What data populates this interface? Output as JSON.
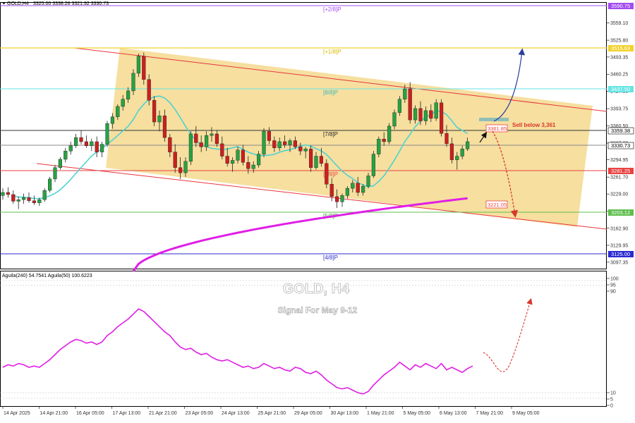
{
  "header": {
    "symbol_text": "GOLD,H4",
    "ohlc_text": "3325.00 3338.26 3321.92 3330.73"
  },
  "indicator": {
    "legend_text": "Aguila(240) 54.7541 Aguila(50) 100.6223",
    "watermark_title": "GOLD, H4",
    "watermark_subtitle": "Signal For May 9-12"
  },
  "annotations": {
    "sell_text": "Sell below 3,361"
  },
  "colors": {
    "bull_candle": "#27a243",
    "bear_candle": "#cc1f1f",
    "sma_short": "#4fd2d0",
    "sma_long": "#e01ee6",
    "channel_fill": "#f5d98e",
    "channel_line": "#e8353b",
    "oscillator": "#e01ee6",
    "blue_arrow": "#2a3f9d",
    "red_arrow": "#d9362b"
  },
  "chart_data": [
    {
      "type": "candlestick",
      "title": "GOLD,H4",
      "ylim": [
        3085,
        3598
      ],
      "y_ticks": [
        3097.35,
        3129.95,
        3162.9,
        3196.15,
        3229.0,
        3261.7,
        3294.95,
        3327.3,
        3360.5,
        3393.75,
        3427.0,
        3460.25,
        3493.35,
        3525.8,
        3559.1
      ],
      "x_labels": [
        "14 Apr 2025",
        "14 Apr 21:00",
        "16 Apr 05:00",
        "17 Apr 13:00",
        "21 Apr 21:00",
        "23 Apr 05:00",
        "24 Apr 13:00",
        "25 Apr 21:00",
        "29 Apr 05:00",
        "30 Apr 13:00",
        "1 May 21:00",
        "5 May 05:00",
        "6 May 13:00",
        "7 May 21:00",
        "9 May 05:00"
      ],
      "candles": [
        [
          3226,
          3240,
          3218,
          3232
        ],
        [
          3232,
          3242,
          3222,
          3228
        ],
        [
          3228,
          3236,
          3210,
          3215
        ],
        [
          3215,
          3224,
          3200,
          3218
        ],
        [
          3218,
          3230,
          3210,
          3222
        ],
        [
          3222,
          3232,
          3212,
          3216
        ],
        [
          3216,
          3226,
          3208,
          3212
        ],
        [
          3212,
          3222,
          3206,
          3218
        ],
        [
          3218,
          3240,
          3214,
          3236
        ],
        [
          3236,
          3262,
          3232,
          3258
        ],
        [
          3258,
          3285,
          3252,
          3280
        ],
        [
          3280,
          3300,
          3276,
          3296
        ],
        [
          3296,
          3318,
          3290,
          3312
        ],
        [
          3312,
          3330,
          3305,
          3322
        ],
        [
          3322,
          3345,
          3318,
          3338
        ],
        [
          3338,
          3352,
          3325,
          3330
        ],
        [
          3330,
          3342,
          3318,
          3322
        ],
        [
          3322,
          3336,
          3312,
          3330
        ],
        [
          3330,
          3340,
          3300,
          3310
        ],
        [
          3310,
          3330,
          3300,
          3325
        ],
        [
          3325,
          3370,
          3320,
          3365
        ],
        [
          3365,
          3385,
          3355,
          3378
        ],
        [
          3378,
          3402,
          3372,
          3398
        ],
        [
          3398,
          3420,
          3390,
          3412
        ],
        [
          3412,
          3435,
          3405,
          3428
        ],
        [
          3428,
          3470,
          3420,
          3462
        ],
        [
          3462,
          3500,
          3455,
          3495
        ],
        [
          3495,
          3502,
          3440,
          3450
        ],
        [
          3450,
          3460,
          3400,
          3410
        ],
        [
          3410,
          3418,
          3360,
          3368
        ],
        [
          3368,
          3390,
          3350,
          3380
        ],
        [
          3380,
          3392,
          3330,
          3338
        ],
        [
          3338,
          3345,
          3300,
          3310
        ],
        [
          3310,
          3325,
          3270,
          3280
        ],
        [
          3280,
          3300,
          3258,
          3270
        ],
        [
          3270,
          3300,
          3262,
          3292
        ],
        [
          3292,
          3350,
          3285,
          3345
        ],
        [
          3345,
          3360,
          3320,
          3328
        ],
        [
          3328,
          3342,
          3310,
          3320
        ],
        [
          3320,
          3350,
          3312,
          3342
        ],
        [
          3342,
          3358,
          3330,
          3345
        ],
        [
          3345,
          3352,
          3320,
          3326
        ],
        [
          3326,
          3340,
          3296,
          3302
        ],
        [
          3302,
          3318,
          3282,
          3288
        ],
        [
          3288,
          3300,
          3272,
          3294
        ],
        [
          3294,
          3320,
          3288,
          3314
        ],
        [
          3314,
          3324,
          3284,
          3290
        ],
        [
          3290,
          3302,
          3268,
          3278
        ],
        [
          3278,
          3292,
          3270,
          3285
        ],
        [
          3285,
          3312,
          3280,
          3306
        ],
        [
          3306,
          3356,
          3300,
          3350
        ],
        [
          3350,
          3358,
          3325,
          3332
        ],
        [
          3332,
          3340,
          3310,
          3318
        ],
        [
          3318,
          3338,
          3312,
          3330
        ],
        [
          3330,
          3342,
          3318,
          3324
        ],
        [
          3324,
          3336,
          3310,
          3332
        ],
        [
          3332,
          3340,
          3316,
          3320
        ],
        [
          3320,
          3328,
          3304,
          3312
        ],
        [
          3312,
          3320,
          3298,
          3316
        ],
        [
          3316,
          3322,
          3272,
          3280
        ],
        [
          3280,
          3310,
          3276,
          3302
        ],
        [
          3302,
          3318,
          3282,
          3288
        ],
        [
          3288,
          3296,
          3240,
          3248
        ],
        [
          3248,
          3260,
          3215,
          3224
        ],
        [
          3224,
          3238,
          3202,
          3214
        ],
        [
          3214,
          3230,
          3204,
          3226
        ],
        [
          3226,
          3244,
          3220,
          3240
        ],
        [
          3240,
          3256,
          3232,
          3250
        ],
        [
          3250,
          3262,
          3225,
          3232
        ],
        [
          3232,
          3248,
          3226,
          3244
        ],
        [
          3244,
          3270,
          3240,
          3264
        ],
        [
          3264,
          3312,
          3260,
          3306
        ],
        [
          3306,
          3340,
          3300,
          3335
        ],
        [
          3335,
          3348,
          3322,
          3330
        ],
        [
          3330,
          3366,
          3325,
          3360
        ],
        [
          3360,
          3392,
          3354,
          3386
        ],
        [
          3386,
          3418,
          3380,
          3412
        ],
        [
          3412,
          3440,
          3405,
          3432
        ],
        [
          3432,
          3445,
          3365,
          3372
        ],
        [
          3372,
          3400,
          3365,
          3394
        ],
        [
          3394,
          3408,
          3362,
          3370
        ],
        [
          3370,
          3398,
          3362,
          3390
        ],
        [
          3390,
          3402,
          3368,
          3375
        ],
        [
          3375,
          3412,
          3370,
          3405
        ],
        [
          3405,
          3412,
          3340,
          3346
        ],
        [
          3346,
          3362,
          3320,
          3326
        ],
        [
          3326,
          3338,
          3288,
          3295
        ],
        [
          3295,
          3310,
          3276,
          3302
        ],
        [
          3302,
          3322,
          3296,
          3316
        ],
        [
          3316,
          3338,
          3312,
          3330
        ]
      ]
    },
    {
      "type": "line",
      "title": "Aguila(240) 54.7541 Aguila(50) 100.6223",
      "ylim": [
        0,
        100
      ],
      "y_ticks": [
        0,
        5,
        10,
        90,
        95,
        100
      ],
      "series": [
        {
          "values": [
            30,
            32,
            31,
            33,
            32,
            30,
            31,
            30,
            33,
            36,
            40,
            44,
            47,
            50,
            52,
            51,
            49,
            50,
            48,
            50,
            55,
            58,
            62,
            65,
            68,
            72,
            76,
            74,
            70,
            66,
            62,
            58,
            55,
            50,
            46,
            44,
            45,
            42,
            40,
            41,
            38,
            36,
            35,
            36,
            34,
            32,
            30,
            31,
            29,
            30,
            33,
            31,
            29,
            30,
            28,
            27,
            30,
            29,
            26,
            25,
            27,
            24,
            20,
            17,
            14,
            13,
            14,
            12,
            10,
            9,
            11,
            16,
            20,
            24,
            27,
            30,
            34,
            31,
            28,
            32,
            30,
            33,
            31,
            29,
            33,
            28,
            30,
            28,
            26,
            29,
            31
          ]
        }
      ]
    }
  ]
}
